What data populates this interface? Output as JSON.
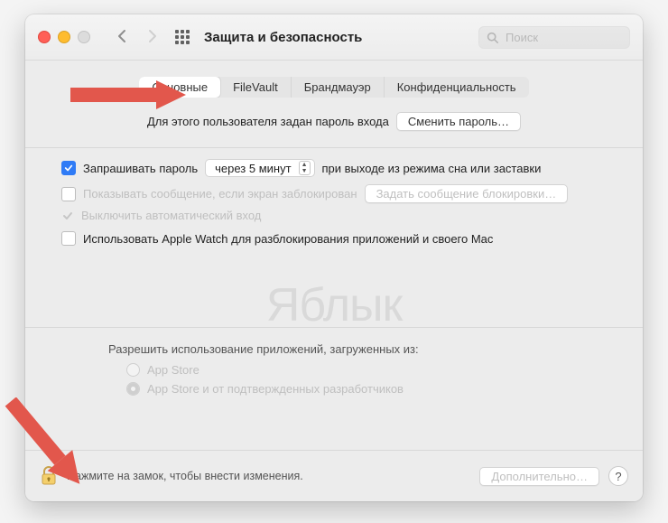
{
  "header": {
    "title": "Защита и безопасность",
    "search_placeholder": "Поиск"
  },
  "tabs": [
    {
      "label": "Основные",
      "active": true
    },
    {
      "label": "FileVault",
      "active": false
    },
    {
      "label": "Брандмауэр",
      "active": false
    },
    {
      "label": "Конфиденциальность",
      "active": false
    }
  ],
  "login_pw": {
    "text": "Для этого пользователя задан пароль входа",
    "button": "Сменить пароль…"
  },
  "options": {
    "require_pw": {
      "checked": true,
      "label_before": "Запрашивать пароль",
      "delay_value": "через 5 минут",
      "label_after": "при выходе из режима сна или заставки"
    },
    "show_message": {
      "checked": false,
      "label": "Показывать сообщение, если экран заблокирован",
      "button": "Задать сообщение блокировки…"
    },
    "disable_autologin": {
      "checked": true,
      "label": "Выключить автоматический вход"
    },
    "apple_watch": {
      "checked": false,
      "label": "Использовать Apple Watch для разблокирования приложений и своего Mac"
    }
  },
  "allow_apps": {
    "heading": "Разрешить использование приложений, загруженных из:",
    "opts": [
      "App Store",
      "App Store и от подтвержденных разработчиков"
    ],
    "selected_index": 1
  },
  "footer": {
    "lock_hint": "Нажмите на замок, чтобы внести изменения.",
    "advanced": "Дополнительно…",
    "help": "?"
  },
  "watermark": "Яблык",
  "colors": {
    "accent": "#2f7bf6",
    "arrow": "#e2574c"
  }
}
